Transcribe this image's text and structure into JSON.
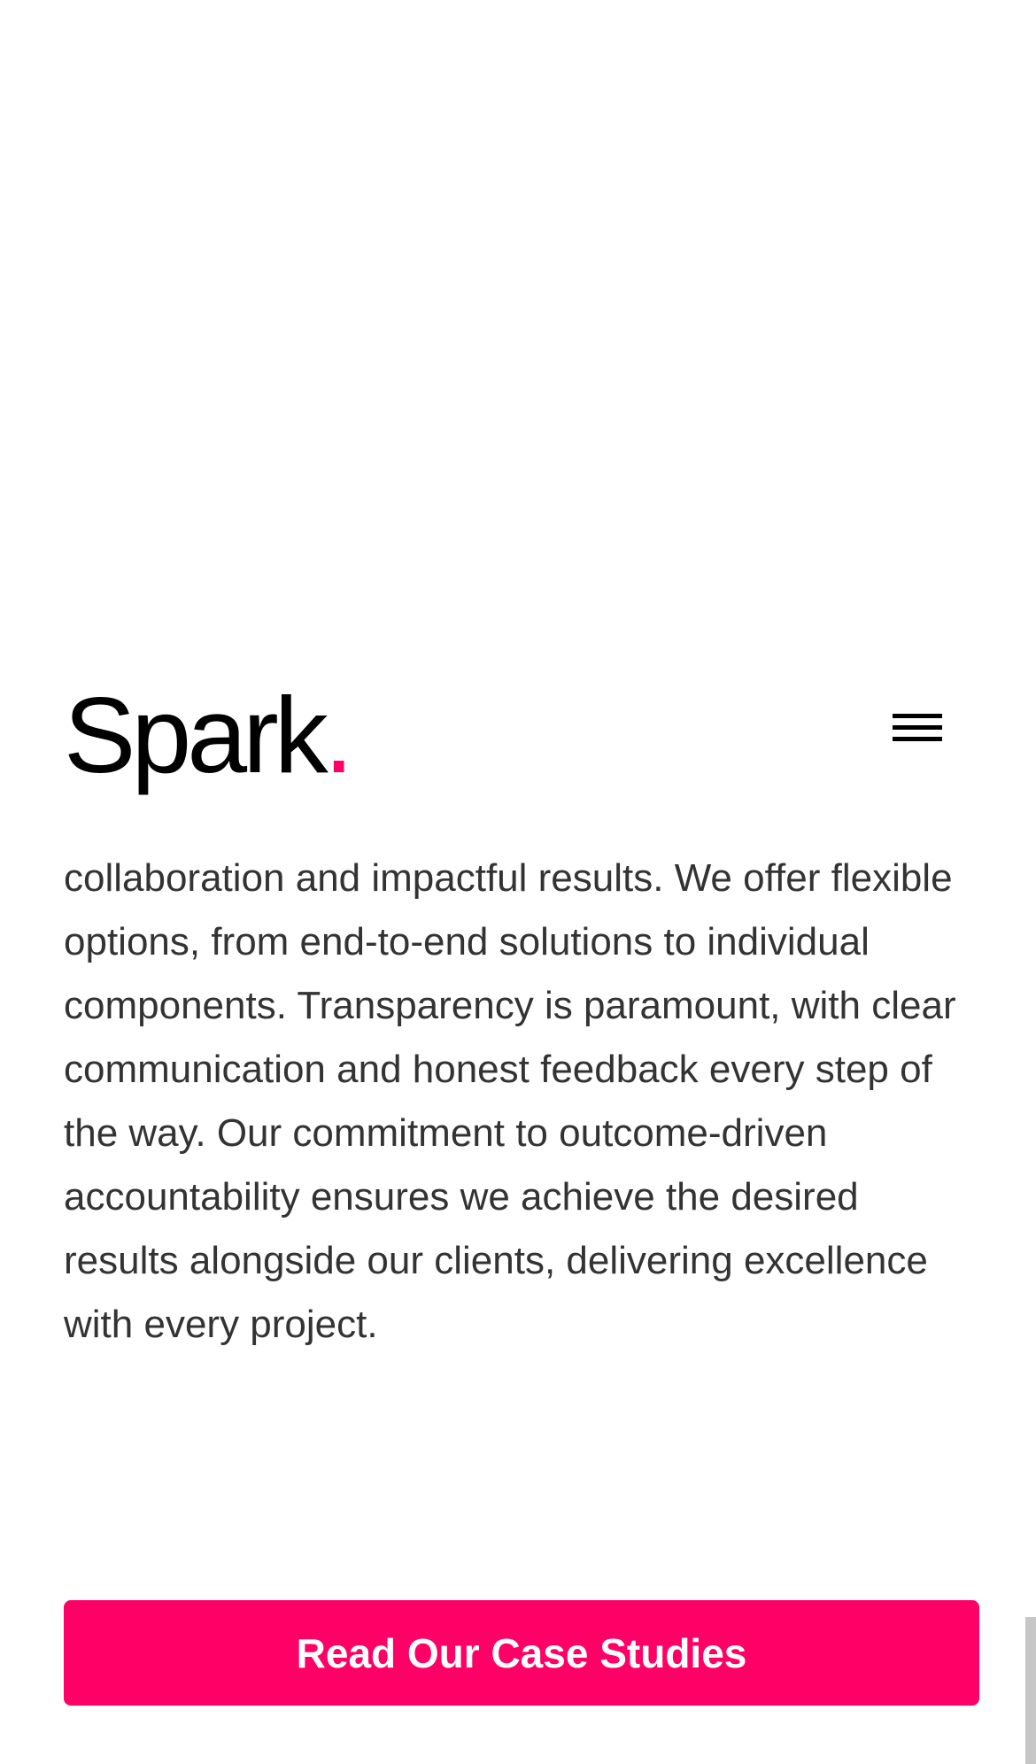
{
  "header": {
    "logo_text": "Spark",
    "logo_dot": ".",
    "menu_icon": "hamburger-menu-icon"
  },
  "content": {
    "paragraph": "collaboration and impactful results. We offer flexible options, from end-to-end solutions to individual components. Transparency is paramount, with clear communication and honest feedback every step of the way. Our commitment to outcome-driven accountability ensures we achieve the desired results alongside our clients, delivering excellence with every project."
  },
  "cta": {
    "label": "Read Our Case Studies"
  },
  "colors": {
    "accent": "#ff0066",
    "text": "#333333",
    "logo": "#000000",
    "background": "#ffffff"
  }
}
